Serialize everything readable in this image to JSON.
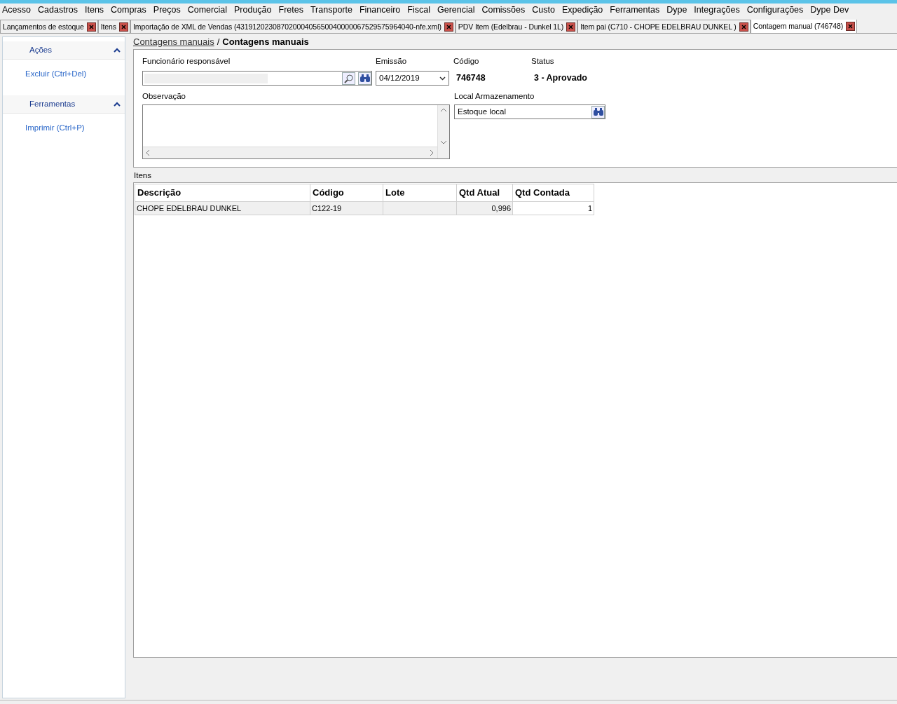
{
  "menu": [
    "Acesso",
    "Cadastros",
    "Itens",
    "Compras",
    "Preços",
    "Comercial",
    "Produção",
    "Fretes",
    "Transporte",
    "Financeiro",
    "Fiscal",
    "Gerencial",
    "Comissões",
    "Custo",
    "Expedição",
    "Ferramentas",
    "Dype",
    "Integrações",
    "Configurações",
    "Dype Dev"
  ],
  "tabs": [
    {
      "label": "Lançamentos de estoque",
      "selected": false
    },
    {
      "label": "Itens",
      "selected": false
    },
    {
      "label": "Importação de XML de Vendas (43191202308702000405650040000067529575964040-nfe.xml)",
      "selected": false
    },
    {
      "label": "PDV Item (Edelbrau - Dunkel 1L)",
      "selected": false
    },
    {
      "label": "Item pai (C710 - CHOPE EDELBRAU DUNKEL )",
      "selected": false
    },
    {
      "label": "Contagem manual (746748)",
      "selected": true
    }
  ],
  "sidebar": {
    "sections": [
      {
        "title": "Ações",
        "expanded": true,
        "items": [
          "Excluir (Ctrl+Del)"
        ]
      },
      {
        "title": "Ferramentas",
        "expanded": true,
        "items": [
          "Imprimir (Ctrl+P)"
        ]
      }
    ]
  },
  "breadcrumb": {
    "link": "Contagens manuais",
    "separator": "/",
    "current": "Contagens manuais"
  },
  "form": {
    "funcionario": {
      "label": "Funcionário responsável"
    },
    "emissao": {
      "label": "Emissão",
      "value": "04/12/2019"
    },
    "codigo": {
      "label": "Código",
      "value": "746748"
    },
    "status": {
      "label": "Status",
      "value": "3 - Aprovado"
    },
    "observacao": {
      "label": "Observação"
    },
    "local": {
      "label": "Local Armazenamento",
      "value": "Estoque local"
    }
  },
  "items": {
    "label": "Itens",
    "columns": [
      "Descrição",
      "Código",
      "Lote",
      "Qtd Atual",
      "Qtd Contada"
    ],
    "rows": [
      {
        "cells": [
          "CHOPE EDELBRAU DUNKEL",
          "C122-19",
          null,
          "0,996",
          "1"
        ]
      }
    ]
  }
}
